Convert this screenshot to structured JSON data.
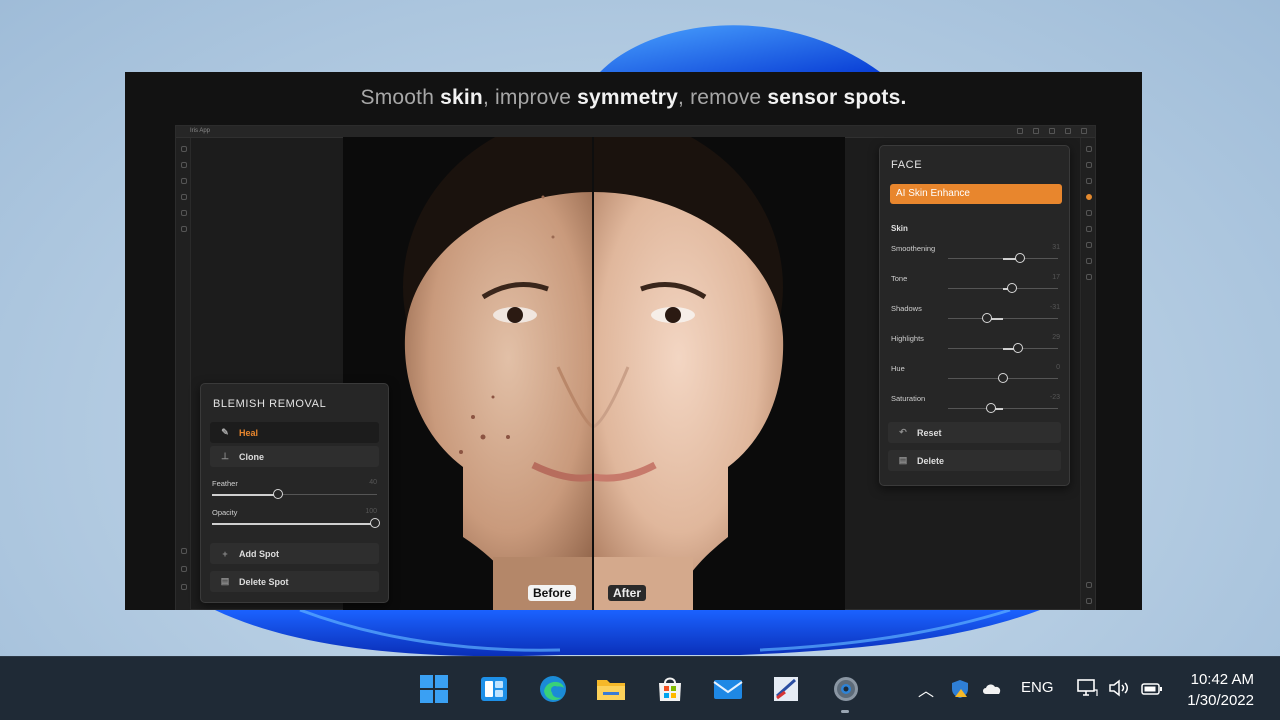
{
  "headline": {
    "p1": "Smooth",
    "p2": "skin",
    "p3": ", improve",
    "p4": "symmetry",
    "p5": ", remove",
    "p6": "sensor spots."
  },
  "app": {
    "name": "Iris App"
  },
  "photo": {
    "before_label": "Before",
    "after_label": "After"
  },
  "blemish_panel": {
    "title": "BLEMISH REMOVAL",
    "tools": [
      {
        "label": "Heal",
        "icon": "brush-icon",
        "active": true
      },
      {
        "label": "Clone",
        "icon": "stamp-icon",
        "active": false
      }
    ],
    "sliders": [
      {
        "label": "Feather",
        "value": "40",
        "fraction": 0.4
      },
      {
        "label": "Opacity",
        "value": "100",
        "fraction": 1.0
      }
    ],
    "actions": [
      {
        "label": "Add Spot",
        "icon": "plus-icon"
      },
      {
        "label": "Delete Spot",
        "icon": "trash-icon"
      }
    ]
  },
  "face_panel": {
    "title": "FACE",
    "ai_button": "AI Skin Enhance",
    "section": "Skin",
    "sliders": [
      {
        "label": "Smoothening",
        "value": "31",
        "fraction": 0.65
      },
      {
        "label": "Tone",
        "value": "17",
        "fraction": 0.58
      },
      {
        "label": "Shadows",
        "value": "-31",
        "fraction": 0.35
      },
      {
        "label": "Highlights",
        "value": "29",
        "fraction": 0.64
      },
      {
        "label": "Hue",
        "value": "0",
        "fraction": 0.5
      },
      {
        "label": "Saturation",
        "value": "-23",
        "fraction": 0.39
      }
    ],
    "actions": [
      {
        "label": "Reset",
        "icon": "undo-icon"
      },
      {
        "label": "Delete",
        "icon": "trash-icon"
      }
    ]
  },
  "taskbar": {
    "apps": [
      "start-icon",
      "widgets-icon",
      "edge-icon",
      "file-explorer-icon",
      "store-icon",
      "mail-icon",
      "paint-icon",
      "settings-icon"
    ],
    "language": "ENG",
    "time": "10:42 AM",
    "date": "1/30/2022"
  },
  "colors": {
    "accent": "#e8862d",
    "taskbar": "#1f2a36"
  }
}
